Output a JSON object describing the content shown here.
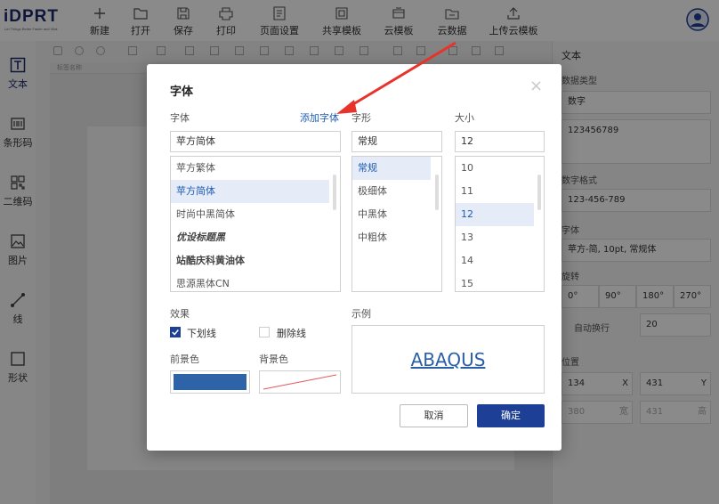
{
  "app": {
    "logo_text": "iDPRT",
    "logo_tagline": "Let Things Better Faster and Vital",
    "colors": {
      "brand": "#1d2a6b",
      "accent": "#1d3f95",
      "link": "#1d5bb5",
      "annotation_arrow": "#e8332b"
    }
  },
  "toolbar": {
    "items": [
      {
        "label": "新建",
        "icon": "plus-icon"
      },
      {
        "label": "打开",
        "icon": "folder-icon"
      },
      {
        "label": "保存",
        "icon": "save-icon"
      },
      {
        "label": "打印",
        "icon": "printer-icon"
      },
      {
        "label": "页面设置",
        "icon": "page-setup-icon"
      },
      {
        "label": "共享模板",
        "icon": "share-template-icon"
      },
      {
        "label": "云模板",
        "icon": "cloud-template-icon"
      },
      {
        "label": "云数据",
        "icon": "cloud-data-icon"
      },
      {
        "label": "上传云模板",
        "icon": "upload-icon"
      }
    ]
  },
  "left_tools": [
    {
      "label": "文本",
      "icon": "text-tool-icon",
      "active": true
    },
    {
      "label": "条形码",
      "icon": "barcode-icon"
    },
    {
      "label": "二维码",
      "icon": "qrcode-icon"
    },
    {
      "label": "图片",
      "icon": "image-icon"
    },
    {
      "label": "线",
      "icon": "line-icon"
    },
    {
      "label": "形状",
      "icon": "shape-icon"
    }
  ],
  "canvas": {
    "tab_label": "标签名称"
  },
  "right_panel": {
    "title": "文本",
    "data_type_label": "数据类型",
    "data_type_value": "数字",
    "content_value": "123456789",
    "format_label": "数字格式",
    "format_value": "123-456-789",
    "font_label": "字体",
    "font_value": "苹方-简, 10pt, 常规体",
    "rotate_label": "旋转",
    "rotate_options": [
      "0°",
      "90°",
      "180°",
      "270°"
    ],
    "wrap_label": "自动换行",
    "wrap_value": "20",
    "position_label": "位置",
    "x_value": "134",
    "x_label": "X",
    "y_value": "431",
    "y_label": "Y",
    "w_value": "380",
    "w_label": "宽",
    "h_value": "431",
    "h_label": "高"
  },
  "font_dialog": {
    "title": "字体",
    "close_symbol": "×",
    "font_label": "字体",
    "add_font_label": "添加字体",
    "style_label": "字形",
    "size_label": "大小",
    "font_value": "苹方简体",
    "style_value": "常规",
    "size_value": "12",
    "font_options": [
      "苹方繁体",
      "苹方简体",
      "时尚中黑简体",
      "优设标题黑",
      "站酷庆科黄油体",
      "思源黑体CN"
    ],
    "style_options": [
      "常规",
      "极细体",
      "中黑体",
      "中粗体"
    ],
    "size_options": [
      "10",
      "11",
      "12",
      "13",
      "14",
      "15"
    ],
    "effects_label": "效果",
    "underline_label": "下划线",
    "underline_checked": true,
    "strikeout_label": "删除线",
    "strikeout_checked": false,
    "preview_label": "示例",
    "preview_text": "ABAQUS",
    "fg_label": "前景色",
    "fg_color": "#2e63a8",
    "bg_label": "背景色",
    "cancel_label": "取消",
    "ok_label": "确定"
  }
}
